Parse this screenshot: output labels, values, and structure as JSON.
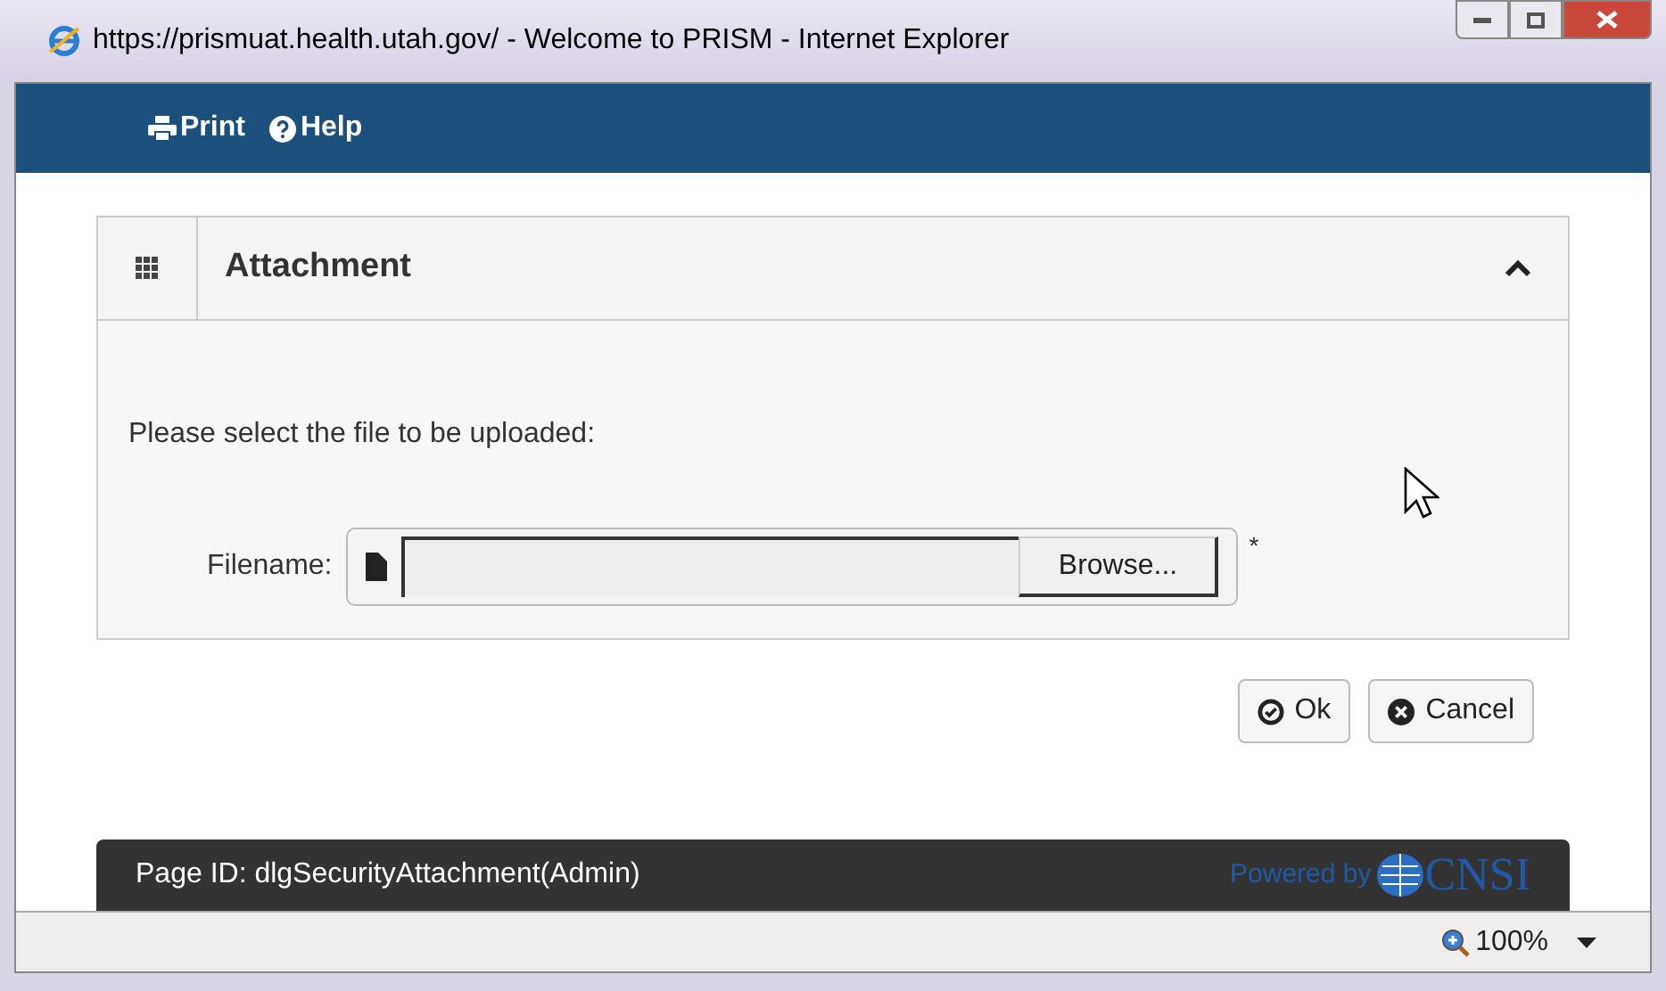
{
  "window": {
    "title": "https://prismuat.health.utah.gov/ - Welcome to PRISM - Internet Explorer"
  },
  "toolbar": {
    "items": [
      {
        "kind": "print",
        "label": "Print"
      },
      {
        "kind": "help",
        "label": "Help"
      }
    ]
  },
  "panel": {
    "title": "Attachment",
    "expanded": true,
    "instruction": "Please select the file to be uploaded:",
    "field": {
      "label": "Filename:",
      "button": "Browse...",
      "required_mark": "*"
    }
  },
  "buttons": [
    {
      "kind": "ok",
      "label": "Ok"
    },
    {
      "kind": "cancel",
      "label": "Cancel"
    }
  ],
  "footer": {
    "page_id": "Page ID: dlgSecurityAttachment(Admin)",
    "powered_by": "Powered by",
    "logo_text": "CNSI"
  },
  "status_bar": {
    "zoom": "100%"
  }
}
